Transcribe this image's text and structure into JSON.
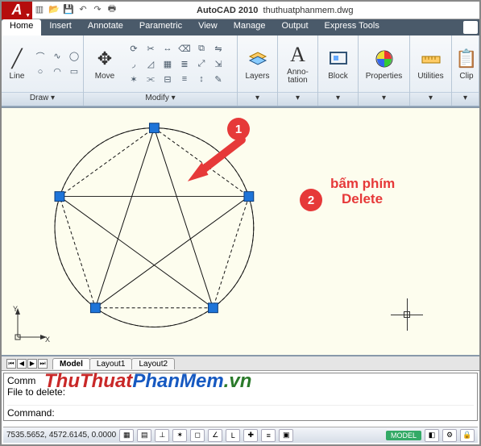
{
  "title": {
    "app": "AutoCAD 2010",
    "doc": "thuthuatphanmem.dwg",
    "logo_letter": "A"
  },
  "tabs": [
    "Home",
    "Insert",
    "Annotate",
    "Parametric",
    "View",
    "Manage",
    "Output",
    "Express Tools"
  ],
  "active_tab": "Home",
  "panels": {
    "draw": {
      "title": "Draw",
      "line_label": "Line"
    },
    "modify": {
      "title": "Modify",
      "move_label": "Move"
    },
    "layers": {
      "title": "Layers",
      "label": "Layers"
    },
    "annotation": {
      "title": "Anno-\ntation",
      "label": "A"
    },
    "block": {
      "title": "Block",
      "label": "Block"
    },
    "properties": {
      "title": "Properties",
      "label": "Properties"
    },
    "utilities": {
      "title": "Utilities",
      "label": "Utilities"
    },
    "clip": {
      "title": "Clip",
      "label": "Clip"
    }
  },
  "annotations": {
    "step1": "1",
    "step2": "2",
    "step2_text_l1": "bấm phím",
    "step2_text_l2": "Delete"
  },
  "layout_tabs": [
    "Model",
    "Layout1",
    "Layout2"
  ],
  "active_layout": "Model",
  "command_window": {
    "line1": "Comm",
    "line2": "File to delete:",
    "prompt": "Command:"
  },
  "watermark": {
    "p1": "ThuThuat",
    "p2": "PhanMem",
    "p3": ".vn"
  },
  "statusbar": {
    "coords": "7535.5652, 4572.6145, 0.0000",
    "model_chip": "MODEL"
  },
  "ucs": {
    "x": "X",
    "y": "Y"
  },
  "icons": {
    "layers": "☰",
    "anno": "A",
    "block": "▭",
    "props": "●",
    "util": "📏"
  }
}
